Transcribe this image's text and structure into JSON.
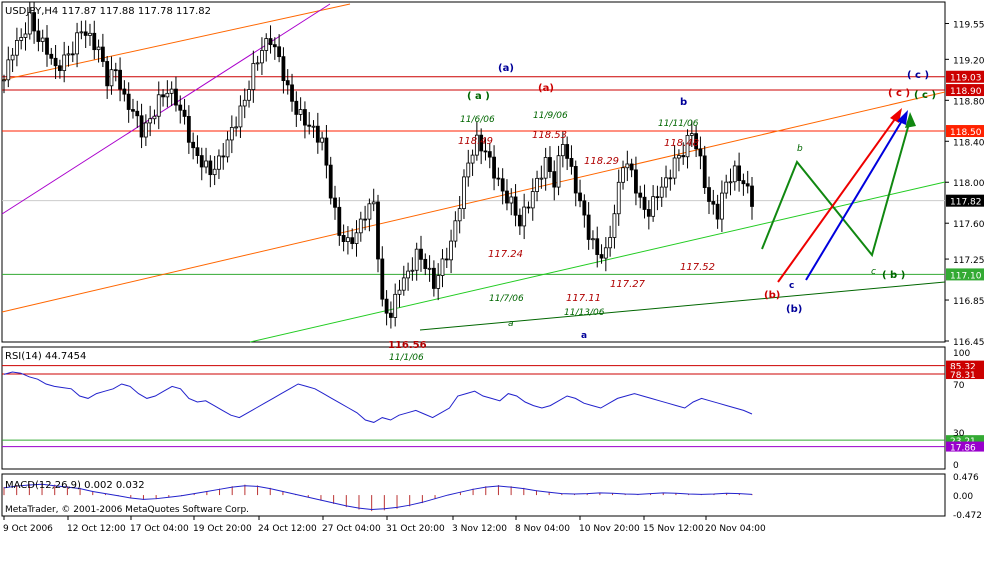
{
  "price_panel": {
    "header": "USDJPY,H4  117.87 117.88 117.78 117.82",
    "axis_ticks": [
      "119.55",
      "119.20",
      "118.80",
      "118.40",
      "118.00",
      "117.60",
      "117.25",
      "116.85",
      "116.45"
    ],
    "current_price": "117.82",
    "line_labels": [
      {
        "text": "119.03",
        "price": 119.03,
        "color": "#cc0000"
      },
      {
        "text": "118.90",
        "price": 118.9,
        "color": "#cc0000"
      },
      {
        "text": "118.50",
        "price": 118.5,
        "color": "#ff2200"
      },
      {
        "text": "117.10",
        "price": 117.1,
        "color": "#33aa33"
      }
    ],
    "price_annotations": [
      "118.49",
      "118.53",
      "118.29",
      "118.48",
      "117.24",
      "117.11",
      "117.27",
      "117.52",
      "116.56"
    ],
    "date_annotations": [
      "11/6/06",
      "11/9/06",
      "11/11/06",
      "11/7/06",
      "11/13/06",
      "11/1/06"
    ],
    "wave_labels": [
      "(a)",
      "( a )",
      "(a)",
      "b",
      "( c )",
      "( c )",
      "( c )",
      "b",
      "c",
      "( b )",
      "(b)",
      "c",
      "(b)",
      "a",
      "a"
    ]
  },
  "rsi_panel": {
    "header": "RSI(14) 44.7454",
    "axis_ticks": [
      "100",
      "70",
      "30",
      "0"
    ],
    "level_labels": [
      "85.32",
      "78.31",
      "23.21",
      "17.86"
    ]
  },
  "macd_panel": {
    "header": "MACD(12,26,9) 0.002 0.032",
    "axis_ticks": [
      "0.476",
      "0.00",
      "-0.472"
    ],
    "watermark": "MetaTrader, © 2001-2006 MetaQuotes Software Corp."
  },
  "time_axis": {
    "labels": [
      "9 Oct 2006",
      "12 Oct 12:00",
      "17 Oct 04:00",
      "19 Oct 20:00",
      "24 Oct 12:00",
      "27 Oct 04:00",
      "31 Oct 20:00",
      "3 Nov 12:00",
      "8 Nov 04:00",
      "10 Nov 20:00",
      "15 Nov 12:00",
      "20 Nov 04:00"
    ]
  },
  "chart_data": {
    "type": "ohlc",
    "symbol": "USDJPY",
    "timeframe": "H4",
    "ohlc_header": {
      "open": 117.87,
      "high": 117.88,
      "low": 117.78,
      "close": 117.82
    },
    "price_range": [
      116.45,
      119.75
    ],
    "close_points": [
      [
        0,
        119.0
      ],
      [
        2,
        119.3
      ],
      [
        4,
        119.4
      ],
      [
        6,
        119.6
      ],
      [
        8,
        119.4
      ],
      [
        10,
        119.3
      ],
      [
        12,
        119.1
      ],
      [
        14,
        119.2
      ],
      [
        16,
        119.3
      ],
      [
        18,
        119.5
      ],
      [
        20,
        119.4
      ],
      [
        22,
        119.3
      ],
      [
        24,
        119.0
      ],
      [
        26,
        119.1
      ],
      [
        28,
        118.8
      ],
      [
        30,
        118.7
      ],
      [
        32,
        118.5
      ],
      [
        34,
        118.6
      ],
      [
        36,
        118.8
      ],
      [
        38,
        118.9
      ],
      [
        40,
        118.8
      ],
      [
        42,
        118.6
      ],
      [
        44,
        118.3
      ],
      [
        46,
        118.2
      ],
      [
        48,
        118.1
      ],
      [
        50,
        118.2
      ],
      [
        52,
        118.4
      ],
      [
        54,
        118.6
      ],
      [
        56,
        118.8
      ],
      [
        58,
        119.1
      ],
      [
        60,
        119.3
      ],
      [
        62,
        119.4
      ],
      [
        64,
        119.2
      ],
      [
        66,
        118.9
      ],
      [
        68,
        118.7
      ],
      [
        70,
        118.6
      ],
      [
        72,
        118.5
      ],
      [
        74,
        118.4
      ],
      [
        76,
        117.9
      ],
      [
        78,
        117.5
      ],
      [
        80,
        117.4
      ],
      [
        82,
        117.5
      ],
      [
        84,
        117.7
      ],
      [
        86,
        117.8
      ],
      [
        88,
        116.8
      ],
      [
        90,
        116.7
      ],
      [
        92,
        117.0
      ],
      [
        94,
        117.1
      ],
      [
        96,
        117.3
      ],
      [
        98,
        117.2
      ],
      [
        100,
        117.0
      ],
      [
        102,
        117.2
      ],
      [
        104,
        117.4
      ],
      [
        106,
        117.8
      ],
      [
        108,
        118.2
      ],
      [
        110,
        118.4
      ],
      [
        112,
        118.3
      ],
      [
        114,
        118.1
      ],
      [
        116,
        117.9
      ],
      [
        118,
        117.8
      ],
      [
        120,
        117.6
      ],
      [
        122,
        117.8
      ],
      [
        124,
        118.0
      ],
      [
        126,
        118.2
      ],
      [
        128,
        118.0
      ],
      [
        130,
        118.4
      ],
      [
        132,
        118.1
      ],
      [
        134,
        117.8
      ],
      [
        136,
        117.5
      ],
      [
        138,
        117.3
      ],
      [
        140,
        117.3
      ],
      [
        142,
        117.7
      ],
      [
        144,
        118.2
      ],
      [
        146,
        118.1
      ],
      [
        148,
        117.8
      ],
      [
        150,
        117.7
      ],
      [
        152,
        117.9
      ],
      [
        154,
        118.0
      ],
      [
        156,
        118.2
      ],
      [
        158,
        118.3
      ],
      [
        160,
        118.5
      ],
      [
        162,
        118.2
      ],
      [
        164,
        117.8
      ],
      [
        166,
        117.7
      ],
      [
        168,
        118.0
      ],
      [
        170,
        118.1
      ],
      [
        172,
        118.0
      ],
      [
        174,
        117.82
      ]
    ],
    "horizontal_levels": [
      119.03,
      118.9,
      118.5,
      117.1
    ],
    "swing_points": [
      {
        "label": "116.56",
        "date": "11/1/06",
        "value": 116.56
      },
      {
        "label": "118.49",
        "date": "11/6/06",
        "value": 118.49
      },
      {
        "label": "117.24",
        "date": "11/7/06",
        "value": 117.24
      },
      {
        "label": "118.53",
        "date": "11/9/06",
        "value": 118.53
      },
      {
        "label": "117.11",
        "value": 117.11
      },
      {
        "label": "118.29",
        "value": 118.29
      },
      {
        "label": "117.27",
        "date": "11/13/06",
        "value": 117.27
      },
      {
        "label": "118.48",
        "date": "11/11/06",
        "value": 118.48
      },
      {
        "label": "117.52",
        "value": 117.52
      }
    ],
    "rsi": {
      "period": 14,
      "value": 44.7454,
      "ylim": [
        0,
        100
      ],
      "levels": [
        85.32,
        78.31,
        23.21,
        17.86
      ],
      "values": [
        78,
        80,
        79,
        76,
        74,
        70,
        68,
        67,
        66,
        60,
        58,
        62,
        64,
        66,
        70,
        68,
        62,
        58,
        60,
        64,
        68,
        66,
        58,
        55,
        56,
        52,
        48,
        44,
        42,
        46,
        50,
        54,
        58,
        62,
        66,
        70,
        68,
        66,
        62,
        58,
        54,
        50,
        46,
        40,
        38,
        42,
        40,
        44,
        46,
        48,
        45,
        42,
        46,
        50,
        60,
        62,
        64,
        60,
        58,
        56,
        62,
        60,
        55,
        52,
        50,
        52,
        56,
        60,
        58,
        54,
        52,
        50,
        54,
        58,
        60,
        62,
        60,
        58,
        56,
        54,
        52,
        50,
        55,
        58,
        56,
        54,
        52,
        50,
        48,
        45
      ]
    },
    "macd": {
      "fast": 12,
      "slow": 26,
      "signal": 9,
      "main": 0.002,
      "signal_value": 0.032,
      "ylim": [
        -0.472,
        0.476
      ],
      "values": [
        0.2,
        0.25,
        0.28,
        0.3,
        0.26,
        0.22,
        0.18,
        0.1,
        0.04,
        -0.02,
        -0.08,
        -0.12,
        -0.1,
        -0.06,
        -0.02,
        0.04,
        0.1,
        0.16,
        0.22,
        0.26,
        0.24,
        0.18,
        0.1,
        0.02,
        -0.06,
        -0.14,
        -0.22,
        -0.3,
        -0.36,
        -0.4,
        -0.38,
        -0.34,
        -0.28,
        -0.2,
        -0.1,
        0.0,
        0.08,
        0.16,
        0.22,
        0.25,
        0.22,
        0.18,
        0.12,
        0.08,
        0.04,
        0.03,
        0.04,
        0.06,
        0.05,
        0.03,
        0.02,
        0.04,
        0.06,
        0.05,
        0.03,
        0.02,
        0.03,
        0.05,
        0.04,
        0.02
      ]
    }
  }
}
